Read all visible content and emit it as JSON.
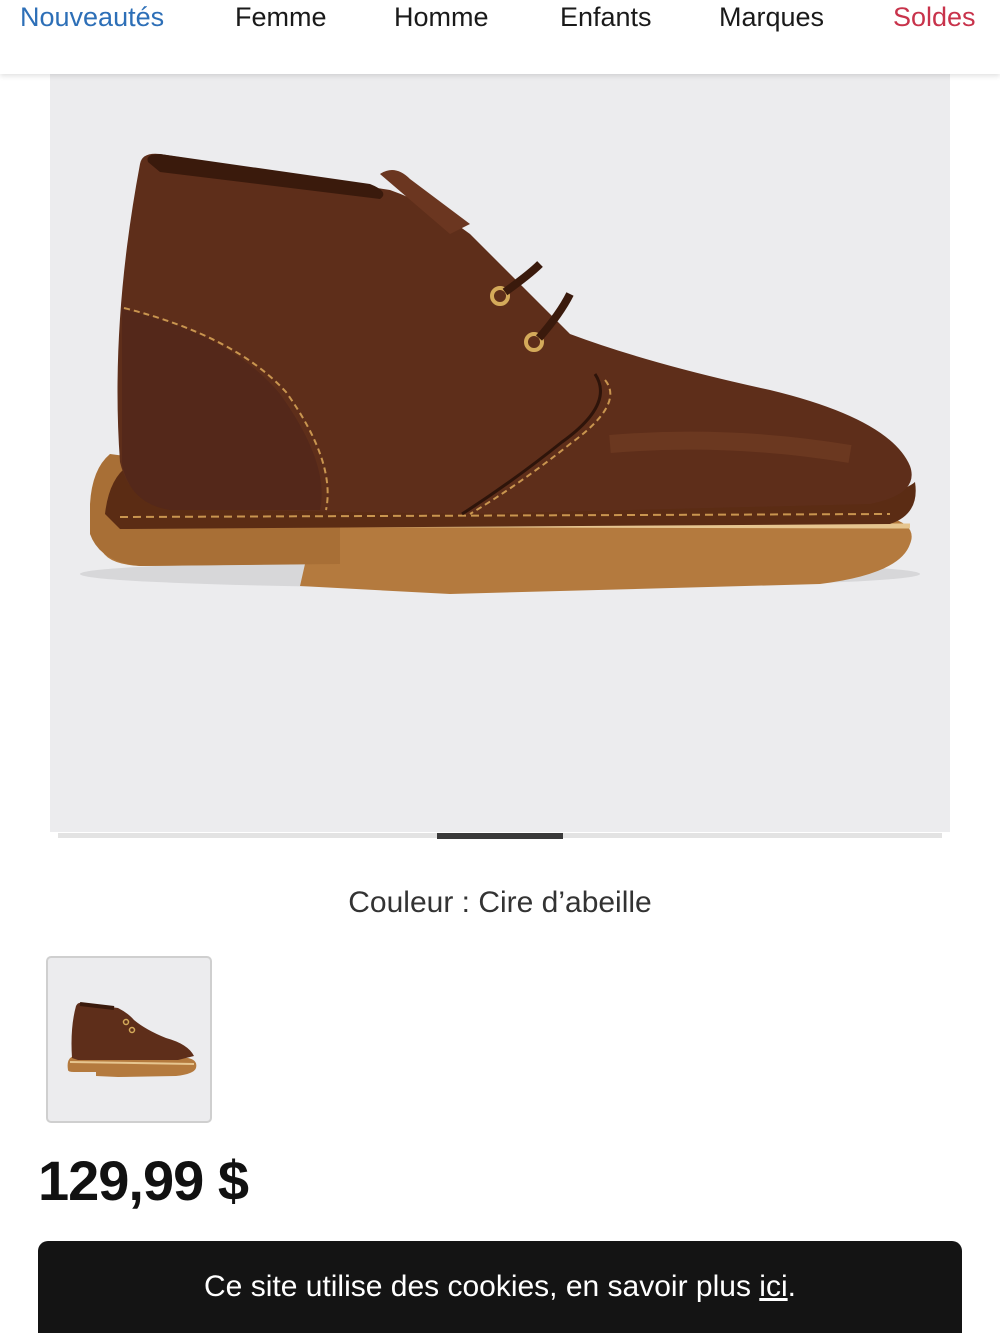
{
  "nav": {
    "items": [
      {
        "label": "Nouveautés",
        "color": "#2d6fb7"
      },
      {
        "label": "Femme",
        "color": "#1a1a1a"
      },
      {
        "label": "Homme",
        "color": "#1a1a1a"
      },
      {
        "label": "Enfants",
        "color": "#1a1a1a"
      },
      {
        "label": "Marques",
        "color": "#1a1a1a"
      },
      {
        "label": "Soldes",
        "color": "#c8334b"
      }
    ]
  },
  "product": {
    "image_alt": "desert-boot-brown-leather",
    "color_label": "Couleur : Cire d’abeille",
    "price": "129,99 $",
    "carousel_position": {
      "current": 4,
      "total": 7
    }
  },
  "cookie_banner": {
    "text": "Ce site utilise des cookies, en savoir plus ",
    "link_label": "ici",
    "suffix": "."
  },
  "colors": {
    "brand_blue": "#2d6fb7",
    "sale_red": "#c8334b",
    "banner_bg": "#141414"
  }
}
